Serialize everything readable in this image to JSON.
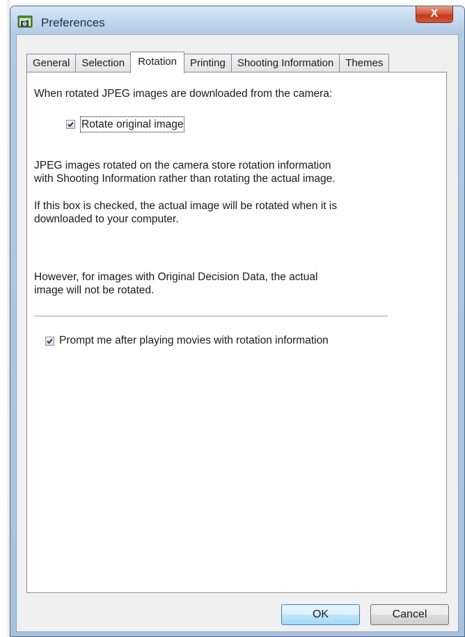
{
  "window": {
    "title": "Preferences",
    "close_label": "X"
  },
  "tabs": [
    {
      "label": "General",
      "active": false
    },
    {
      "label": "Selection",
      "active": false
    },
    {
      "label": "Rotation",
      "active": true
    },
    {
      "label": "Printing",
      "active": false
    },
    {
      "label": "Shooting Information",
      "active": false
    },
    {
      "label": "Themes",
      "active": false
    }
  ],
  "rotation": {
    "intro": "When rotated JPEG images are downloaded from the camera:",
    "rotate_checkbox": {
      "label": "Rotate original image",
      "checked": true
    },
    "para1_line1": "JPEG images rotated on the camera store rotation information",
    "para1_line2": "with Shooting Information rather than rotating the actual image.",
    "para2_line1": "If this box is checked, the actual image will be rotated when it is",
    "para2_line2": "downloaded to your computer.",
    "para3_line1": "However, for images with Original Decision Data, the actual",
    "para3_line2": "image will not be rotated.",
    "prompt_checkbox": {
      "label": "Prompt me after playing movies with rotation information",
      "checked": true
    }
  },
  "buttons": {
    "ok": "OK",
    "cancel": "Cancel"
  },
  "colors": {
    "title_bar": "#c2d6ec",
    "close_button": "#c23a1c",
    "default_button_border": "#3c7fb1",
    "check_mark": "#1f3a6b"
  },
  "icons": {
    "app": "camera-window-icon",
    "close": "close-icon",
    "check": "check-icon"
  }
}
